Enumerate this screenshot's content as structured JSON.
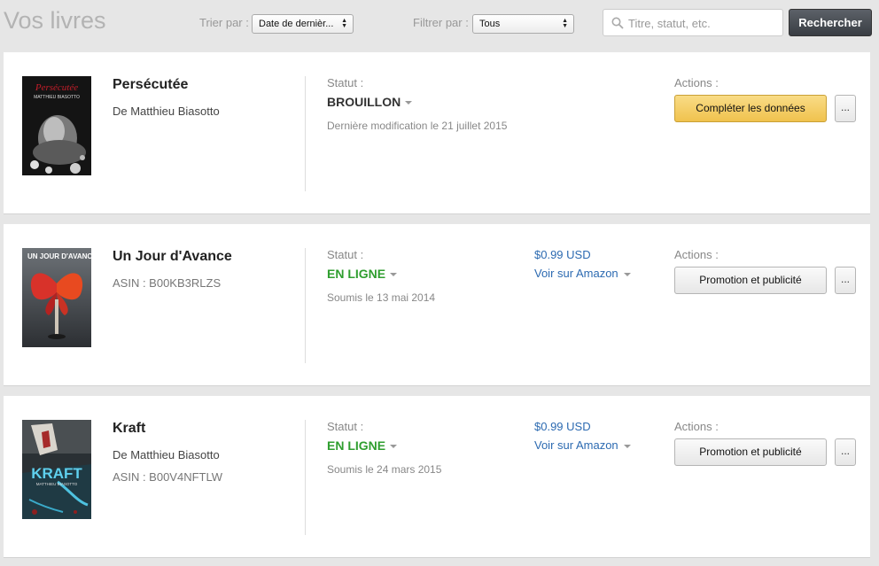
{
  "header": {
    "title": "Vos livres",
    "sort_label": "Trier par :",
    "sort_value": "Date de dernièr...",
    "filter_label": "Filtrer par :",
    "filter_value": "Tous",
    "search_placeholder": "Titre, statut, etc.",
    "search_button": "Rechercher"
  },
  "books": [
    {
      "title": "Persécutée",
      "line1": "De Matthieu Biasotto",
      "line2": "",
      "cover_title": "Persécutée",
      "cover_author": "MATTHIEU BIASOTTO",
      "status_label": "Statut :",
      "status": "BROUILLON",
      "status_detail": "Dernière modification le 21 juillet 2015",
      "price": "",
      "amazon_link": "",
      "actions_label": "Actions :",
      "action_button": "Compléter les données",
      "more_button": "..."
    },
    {
      "title": "Un Jour d'Avance",
      "line1": "ASIN : B00KB3RLZS",
      "line2": "",
      "cover_title": "UN JOUR D'AVANCE",
      "cover_author": "",
      "status_label": "Statut :",
      "status": "EN LIGNE",
      "status_detail": "Soumis le 13 mai 2014",
      "price": "$0.99 USD",
      "amazon_link": "Voir sur Amazon",
      "actions_label": "Actions :",
      "action_button": "Promotion et publicité",
      "more_button": "..."
    },
    {
      "title": "Kraft",
      "line1": "De Matthieu Biasotto",
      "line2": "ASIN : B00V4NFTLW",
      "cover_title": "KRAFT",
      "cover_author": "MATTHIEU BIASOTTO",
      "status_label": "Statut :",
      "status": "EN LIGNE",
      "status_detail": "Soumis le 24 mars 2015",
      "price": "$0.99 USD",
      "amazon_link": "Voir sur Amazon",
      "actions_label": "Actions :",
      "action_button": "Promotion et publicité",
      "more_button": "..."
    }
  ],
  "colors": {
    "status_live": "#2f9e2f",
    "link": "#2c6ab1",
    "primary_button": "#f0c24e",
    "search_button": "#393d43"
  },
  "icons": {
    "search": "search-icon",
    "select_arrows": "select-arrows-icon",
    "dropdown_caret": "caret-down-icon"
  }
}
